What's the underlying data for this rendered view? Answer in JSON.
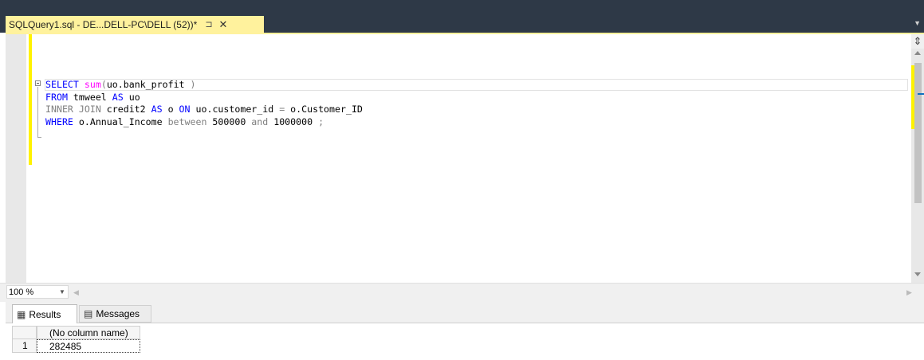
{
  "document_tab": {
    "title": "SQLQuery1.sql - DE...DELL-PC\\DELL (52))*",
    "pin_glyph": "⊐",
    "close_glyph": "✕"
  },
  "editor": {
    "lines": [
      [
        {
          "t": "SELECT ",
          "c": "kw"
        },
        {
          "t": "sum",
          "c": "fn"
        },
        {
          "t": "(",
          "c": "gr"
        },
        {
          "t": "uo.bank_profit ",
          "c": ""
        },
        {
          "t": ")",
          "c": "gr"
        }
      ],
      [
        {
          "t": "FROM ",
          "c": "kw"
        },
        {
          "t": "tmweel ",
          "c": ""
        },
        {
          "t": "AS ",
          "c": "kw"
        },
        {
          "t": "uo",
          "c": ""
        }
      ],
      [
        {
          "t": "INNER JOIN ",
          "c": "gr"
        },
        {
          "t": "credit2 ",
          "c": ""
        },
        {
          "t": "AS ",
          "c": "kw"
        },
        {
          "t": "o ",
          "c": ""
        },
        {
          "t": "ON ",
          "c": "kw"
        },
        {
          "t": "uo.customer_id ",
          "c": ""
        },
        {
          "t": "= ",
          "c": "gr"
        },
        {
          "t": "o.Customer_ID",
          "c": ""
        }
      ],
      [
        {
          "t": "WHERE ",
          "c": "kw"
        },
        {
          "t": "o.Annual_Income ",
          "c": ""
        },
        {
          "t": "between ",
          "c": "gr"
        },
        {
          "t": "500000 ",
          "c": ""
        },
        {
          "t": "and ",
          "c": "gr"
        },
        {
          "t": "1000000 ",
          "c": ""
        },
        {
          "t": ";",
          "c": "gr"
        }
      ]
    ]
  },
  "zoom": {
    "value": "100 %"
  },
  "results_tabs": {
    "results_label": "Results",
    "messages_label": "Messages"
  },
  "results_grid": {
    "column_header": "(No column name)",
    "rows": [
      {
        "row_number": "1",
        "value": "282485"
      }
    ]
  },
  "colors": {
    "tab_active": "#fff29d",
    "chrome_dark": "#2e3947",
    "keyword": "#0000ff",
    "function": "#ff00ff",
    "operator": "#808080",
    "change_marker": "#fff200"
  }
}
